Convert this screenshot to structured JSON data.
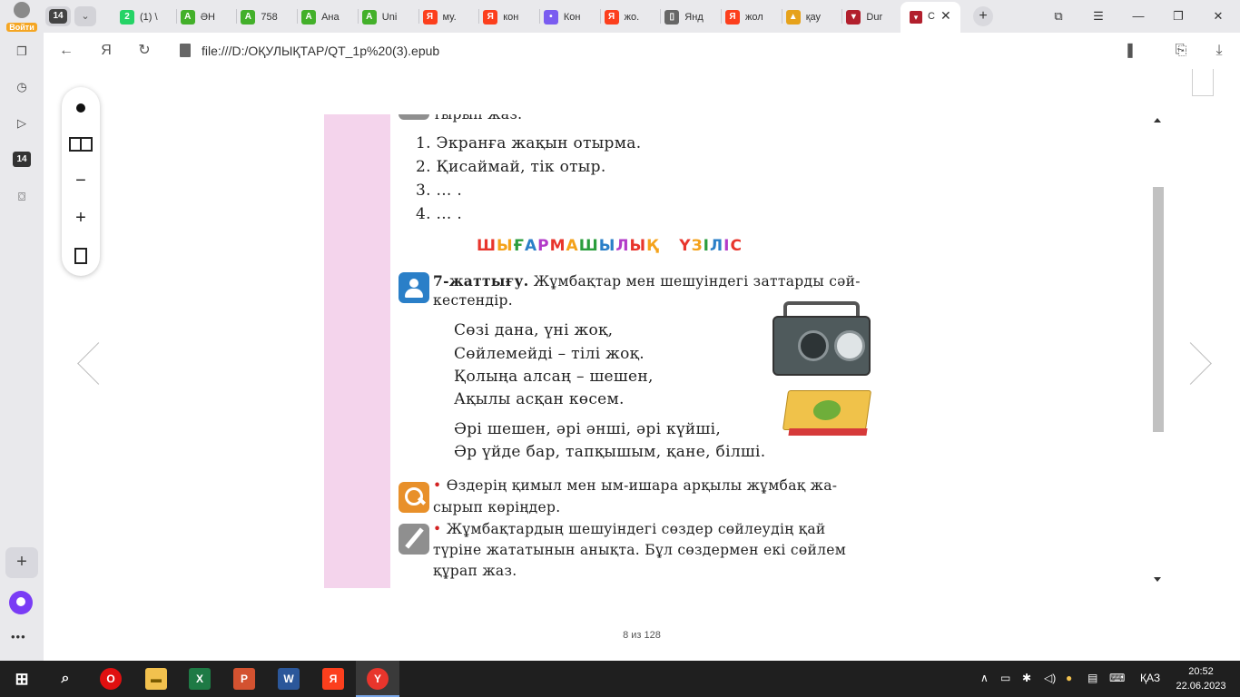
{
  "browser": {
    "login_label": "Войти",
    "tab_count": "14",
    "tabs": [
      {
        "icon": "whatsapp-icon",
        "title": "(1) \\",
        "color": "#25d366",
        "glyph": "2"
      },
      {
        "icon": "green-a-icon",
        "title": "ӘН",
        "color": "#43b02a",
        "glyph": "A"
      },
      {
        "icon": "green-a-icon",
        "title": "758",
        "color": "#43b02a",
        "glyph": "A"
      },
      {
        "icon": "green-a-icon",
        "title": "Ана",
        "color": "#43b02a",
        "glyph": "A"
      },
      {
        "icon": "green-a-icon",
        "title": "Uni",
        "color": "#43b02a",
        "glyph": "A"
      },
      {
        "icon": "yandex-icon",
        "title": "му.",
        "color": "#fc3f1d",
        "glyph": "Я"
      },
      {
        "icon": "yandex-icon",
        "title": "кон",
        "color": "#fc3f1d",
        "glyph": "Я"
      },
      {
        "icon": "collections-icon",
        "title": "Кон",
        "color": "#7a5cf0",
        "glyph": "•"
      },
      {
        "icon": "yandex-icon",
        "title": "жо.",
        "color": "#fc3f1d",
        "glyph": "Я"
      },
      {
        "icon": "document-icon",
        "title": "Янд",
        "color": "#666666",
        "glyph": "▯"
      },
      {
        "icon": "yandex-icon",
        "title": "жол",
        "color": "#fc3f1d",
        "glyph": "Я"
      },
      {
        "icon": "image-icon",
        "title": "қау",
        "color": "#e6a21b",
        "glyph": "▲"
      },
      {
        "icon": "pdf-icon",
        "title": "Dur",
        "color": "#b21f2d",
        "glyph": "▾"
      }
    ],
    "active_tab_title": "С",
    "url": "file:///D:/ОҚУЛЫҚТАР/QT_1р%20(3).epub",
    "sidebar_badge": "14"
  },
  "viewer": {
    "page_indicator": "8 из 128"
  },
  "page": {
    "top_cut_line": "тырып жаз.",
    "list": [
      "1. Экранға жақын отырма.",
      "2. Қисаймай, тік отыр.",
      "3. ... .",
      "4. ... ."
    ],
    "heading_words": [
      "ШЫҒАРМАШЫЛЫҚ",
      "ҮЗІЛІС"
    ],
    "heading_colors": [
      "#e8352c",
      "#f4a21a",
      "#2a9d3c",
      "#2a7fc8",
      "#b23ac8",
      "#e8352c",
      "#f4a21a",
      "#2a9d3c",
      "#2a7fc8",
      "#b23ac8",
      "#e8352c",
      "#f4a21a"
    ],
    "exercise_label": "7-жаттығу.",
    "exercise_text_1": "Жұмбақтар мен шешуіндегі заттарды сәй-",
    "exercise_text_2": "кестендір.",
    "riddle1": [
      "Сөзі дана, үні жоқ,",
      "Сөйлемейді – тілі жоқ.",
      "Қолыңа алсаң – шешен,",
      "Ақылы асқан көсем."
    ],
    "riddle2": [
      "Әрі шешен, әрі әнші, әрі күйші,",
      "Әр үйде бар, тапқышым, қане, білші."
    ],
    "task1_line1": "Өздерің қимыл мен ым-ишара арқылы жұмбақ жа-",
    "task1_line2": "сырып көріңдер.",
    "task2_line1": "Жұмбақтардың шешуіндегі сөздер сөйлеудің қай",
    "task2_line2": "түріне жататынын анықта. Бұл сөздермен екі сөйлем",
    "task2_line3": "құрап жаз.",
    "bullet": "•"
  },
  "taskbar": {
    "language": "ҚАЗ",
    "time": "20:52",
    "date": "22.06.2023"
  }
}
